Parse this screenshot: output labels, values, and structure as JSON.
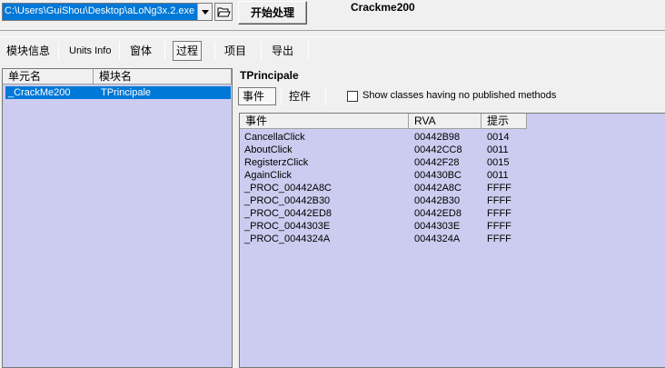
{
  "top": {
    "file_path": "C:\\Users\\GuiShou\\Desktop\\aLoNg3x.2.exe",
    "start_label": "开始处理",
    "app_title": "Crackme200"
  },
  "tabs": [
    "模块信息",
    "Units Info",
    "窗体",
    "过程",
    "项目",
    "导出"
  ],
  "left": {
    "headers": [
      "单元名",
      "模块名"
    ],
    "rows": [
      {
        "unit": "_CrackMe200",
        "module": "TPrincipale"
      }
    ]
  },
  "right": {
    "class_name": "TPrincipale",
    "subtabs": [
      "事件",
      "控件"
    ],
    "checkbox_label": "Show classes having no published methods",
    "headers": [
      "事件",
      "RVA",
      "提示"
    ],
    "rows": [
      {
        "event": "CancellaClick",
        "rva": "00442B98",
        "hint": "0014"
      },
      {
        "event": "AboutClick",
        "rva": "00442CC8",
        "hint": "0011"
      },
      {
        "event": "RegisterzClick",
        "rva": "00442F28",
        "hint": "0015"
      },
      {
        "event": "AgainClick",
        "rva": "004430BC",
        "hint": "0011"
      },
      {
        "event": "_PROC_00442A8C",
        "rva": "00442A8C",
        "hint": "FFFF"
      },
      {
        "event": "_PROC_00442B30",
        "rva": "00442B30",
        "hint": "FFFF"
      },
      {
        "event": "_PROC_00442ED8",
        "rva": "00442ED8",
        "hint": "FFFF"
      },
      {
        "event": "_PROC_0044303E",
        "rva": "0044303E",
        "hint": "FFFF"
      },
      {
        "event": "_PROC_0044324A",
        "rva": "0044324A",
        "hint": "FFFF"
      }
    ]
  },
  "icons": {
    "open": "folder-open-icon",
    "dropdown": "chevron-down-icon"
  },
  "colors": {
    "selection": "#0078d7",
    "list_bg": "#ccccf0"
  }
}
